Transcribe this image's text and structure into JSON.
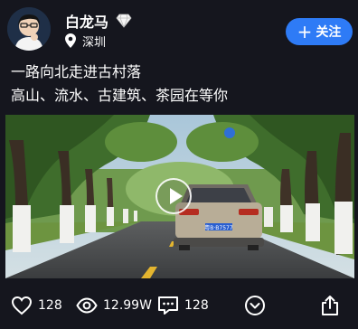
{
  "profile": {
    "name": "白龙马",
    "location": "深圳",
    "follow_label": "关注"
  },
  "post": {
    "line1": "一路向北走进古村落",
    "line2": "高山、流水、古建筑、茶园在等你"
  },
  "video": {
    "plate_text": "粤B·B7577"
  },
  "actions": {
    "likes": "128",
    "views": "12.99W",
    "comments": "128"
  },
  "colors": {
    "background": "#15161e",
    "accent": "#2e7bf6"
  }
}
